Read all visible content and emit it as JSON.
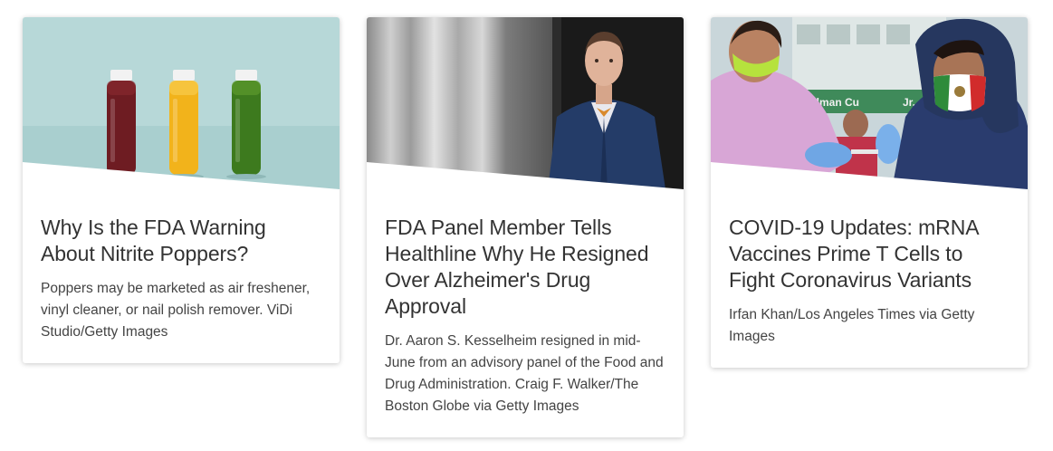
{
  "articles": [
    {
      "title": "Why Is the FDA Warning About Nitrite Poppers?",
      "caption": "Poppers may be marketed as air freshener, vinyl cleaner, or nail polish remover. ViDi Studio/Getty Images"
    },
    {
      "title": "FDA Panel Member Tells Healthline Why He Resigned Over Alzheimer's Drug Approval",
      "caption": "Dr. Aaron S. Kesselheim resigned in mid-June from an advisory panel of the Food and Drug Administration. Craig F. Walker/The Boston Globe via Getty Images"
    },
    {
      "title": "COVID-19 Updates: mRNA Vaccines Prime T Cells to Fight Coronavirus Variants",
      "caption": "Irfan Khan/Los Angeles Times via Getty Images",
      "sign_text": "uncilman Cu",
      "sign_text_2": "Jr."
    }
  ],
  "colors": {
    "title": "#333333",
    "caption": "#444444",
    "card_bg": "#ffffff"
  }
}
